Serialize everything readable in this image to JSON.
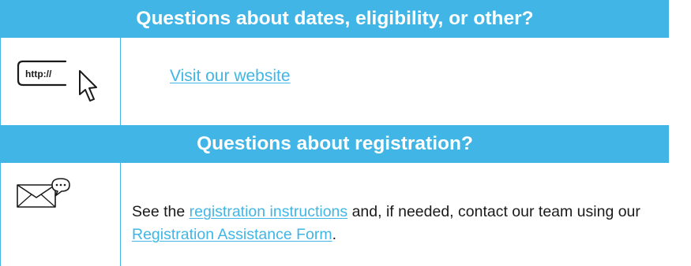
{
  "sections": {
    "general": {
      "heading": "Questions about dates, eligibility, or other?",
      "icon": "web-url-cursor-icon",
      "icon_text": "http://",
      "link_label": "Visit our website"
    },
    "registration": {
      "heading": "Questions about registration?",
      "icon": "envelope-chat-icon",
      "text_before": "See the ",
      "instructions_link": "registration instructions",
      "text_middle": " and, if needed, contact our team using our ",
      "form_link": "Registration Assistance Form",
      "text_after": "."
    }
  },
  "colors": {
    "accent": "#41b6e6",
    "header_text": "#ffffff",
    "body_text": "#1a1a1a"
  }
}
